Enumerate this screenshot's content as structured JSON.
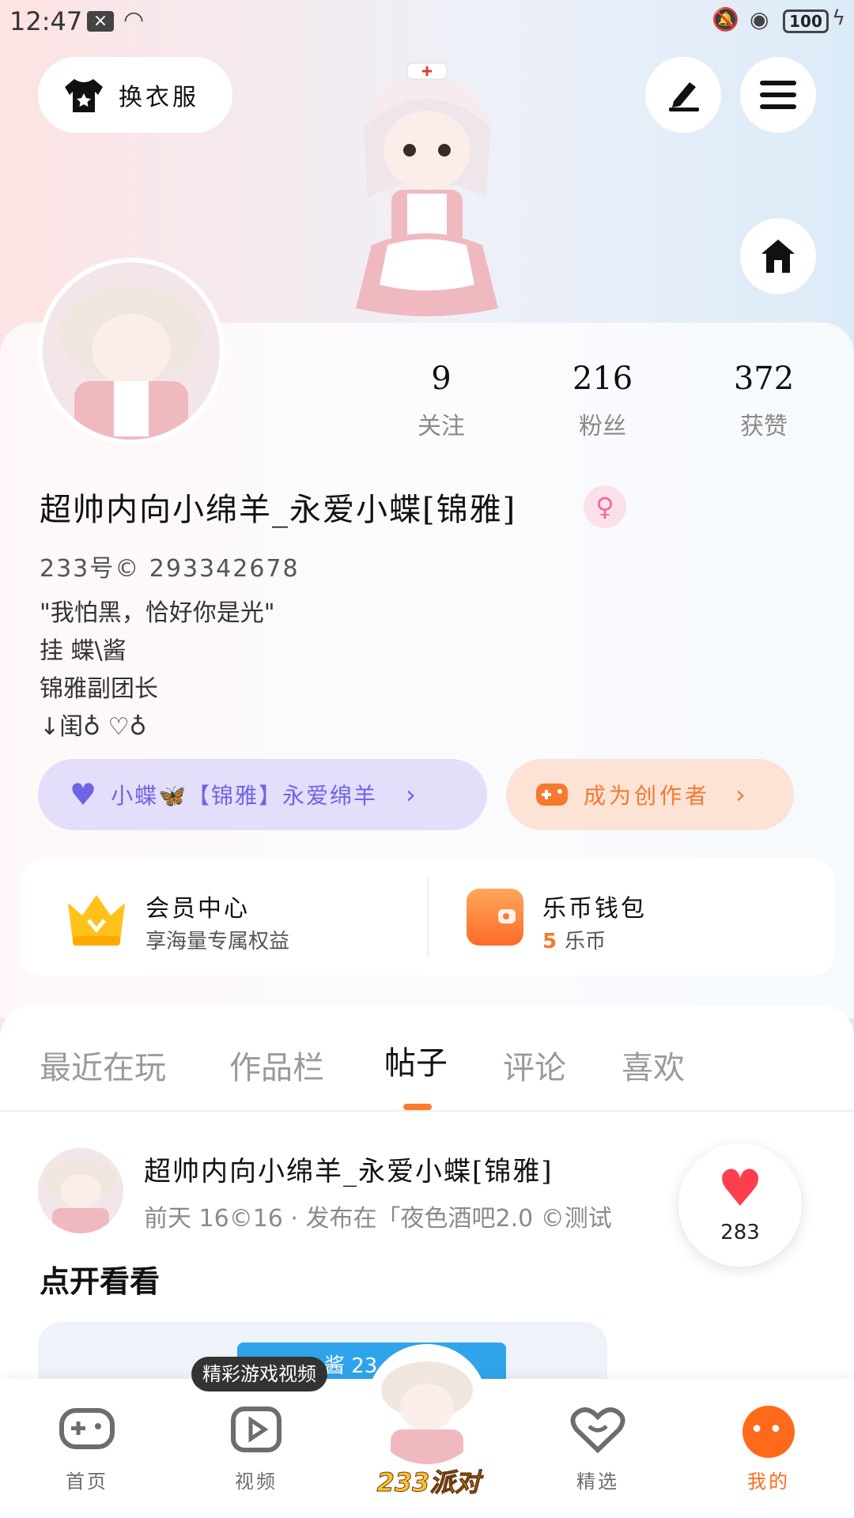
{
  "status_bar": {
    "time": "12:47",
    "battery": "100"
  },
  "top": {
    "dress_label": "换衣服"
  },
  "stats": [
    {
      "value": "9",
      "label": "关注"
    },
    {
      "value": "216",
      "label": "粉丝"
    },
    {
      "value": "372",
      "label": "获赞"
    }
  ],
  "profile": {
    "username": "超帅内向小绵羊_永爱小蝶[锦雅]",
    "gender_symbol": "♀",
    "uid": "233号© 293342678",
    "bio": [
      "\"我怕黑，恰好你是光\"",
      "挂 蝶\\酱",
      "锦雅副团长",
      "↓闺♁ ♡♁"
    ]
  },
  "pills": {
    "team": "小蝶🦋【锦雅】永爱绵羊",
    "creator": "成为创作者"
  },
  "cards": {
    "vip_title": "会员中心",
    "vip_sub": "享海量专属权益",
    "wallet_title": "乐币钱包",
    "wallet_amount": "5",
    "wallet_unit": "乐币"
  },
  "tabs": [
    "最近在玩",
    "作品栏",
    "帖子",
    "评论",
    "喜欢"
  ],
  "active_tab": "帖子",
  "post": {
    "author": "超帅内向小绵羊_永爱小蝶[锦雅]",
    "meta": "前天 16©16 · 发布在「夜色酒吧2.0 ©测试",
    "title": "点开看看",
    "media_text": "酱 23",
    "likes": "283"
  },
  "nav": {
    "home": "首页",
    "video": "视频",
    "video_tooltip": "精彩游戏视频",
    "party": "233派对",
    "featured": "精选",
    "mine": "我的"
  },
  "colors": {
    "accent": "#ff6a1a",
    "purple": "#6f63e8",
    "like": "#ff3e4d"
  }
}
